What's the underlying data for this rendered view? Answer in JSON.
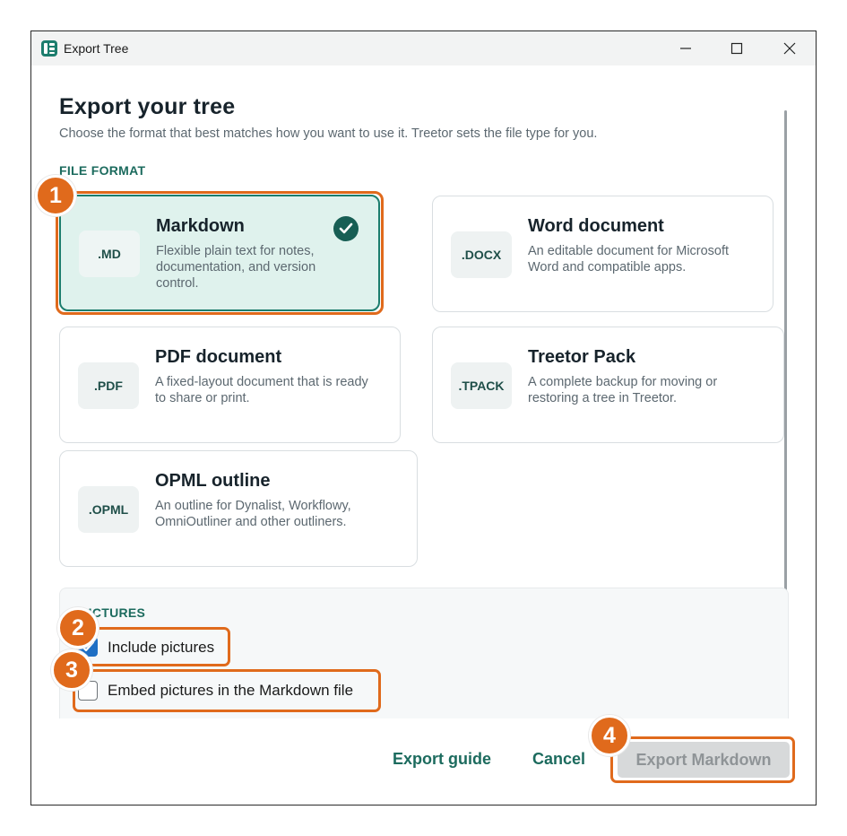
{
  "window": {
    "title": "Export Tree"
  },
  "heading": "Export your tree",
  "subtitle": "Choose the format that best matches how you want to use it. Treetor sets the file type for you.",
  "file_format": {
    "label": "FILE FORMAT",
    "formats": [
      {
        "badge": ".MD",
        "title": "Markdown",
        "description": "Flexible plain text for notes, documentation, and version control.",
        "selected": true
      },
      {
        "badge": ".DOCX",
        "title": "Word document",
        "description": "An editable document for Microsoft Word and compatible apps.",
        "selected": false
      },
      {
        "badge": ".PDF",
        "title": "PDF document",
        "description": "A fixed-layout document that is ready to share or print.",
        "selected": false
      },
      {
        "badge": ".TPACK",
        "title": "Treetor Pack",
        "description": "A complete backup for moving or restoring a tree in Treetor.",
        "selected": false
      },
      {
        "badge": ".OPML",
        "title": "OPML outline",
        "description": "An outline for Dynalist, Workflowy, OmniOutliner and other outliners.",
        "selected": false
      }
    ]
  },
  "pictures": {
    "label": "PICTURES",
    "include_label": "Include pictures",
    "include_checked": true,
    "embed_label": "Embed pictures in the Markdown file",
    "embed_checked": false
  },
  "footer": {
    "guide_label": "Export guide",
    "cancel_label": "Cancel",
    "primary_label": "Export Markdown"
  },
  "callouts": [
    "1",
    "2",
    "3",
    "4"
  ],
  "colors": {
    "accent": "#1c7d6d",
    "callout": "#e06a1c"
  }
}
